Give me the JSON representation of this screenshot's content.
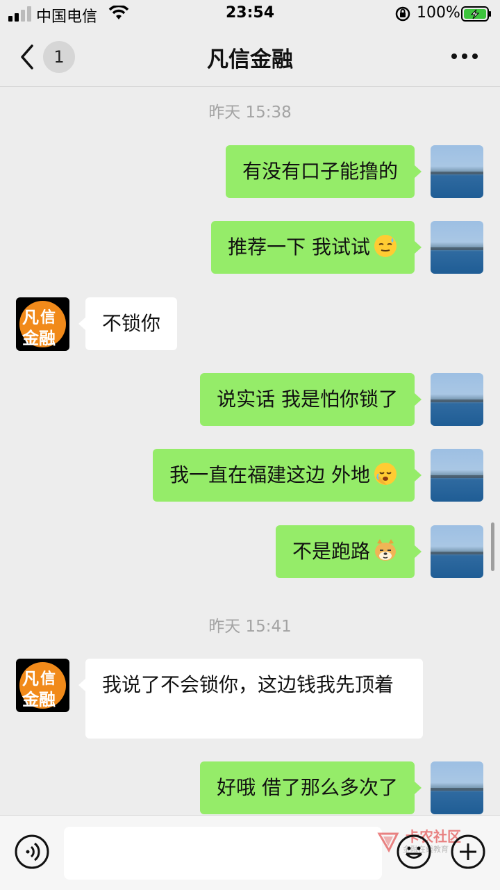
{
  "status_bar": {
    "carrier": "中国电信",
    "time": "23:54",
    "battery": "100%"
  },
  "header": {
    "unread_count": "1",
    "title": "凡信金融"
  },
  "contact_avatar": {
    "chars": [
      "凡",
      "信",
      "金",
      "融"
    ]
  },
  "messages": [
    {
      "type": "timestamp",
      "text": "昨天 15:38"
    },
    {
      "type": "out",
      "text": "有没有口子能撸的"
    },
    {
      "type": "out",
      "text": "推荐一下 我试试",
      "emoji": "sweat-smile-emoji"
    },
    {
      "type": "in",
      "text": "不锁你"
    },
    {
      "type": "out",
      "text": "说实话 我是怕你锁了"
    },
    {
      "type": "out",
      "text": "我一直在福建这边 外地",
      "emoji": "facepalm-emoji"
    },
    {
      "type": "out",
      "text": "不是跑路",
      "emoji": "doge-emoji"
    },
    {
      "type": "timestamp",
      "text": "昨天 15:41"
    },
    {
      "type": "in",
      "text": "我说了不会锁你，这边钱我先顶着"
    },
    {
      "type": "out",
      "text": "好哦 借了那么多次了"
    }
  ],
  "input": {
    "placeholder": ""
  },
  "watermark": {
    "text": "卡农社区",
    "sub": "金融在线教育"
  },
  "colors": {
    "outgoing_bubble": "#95ec69",
    "incoming_bubble": "#ffffff",
    "background": "#ededed"
  }
}
